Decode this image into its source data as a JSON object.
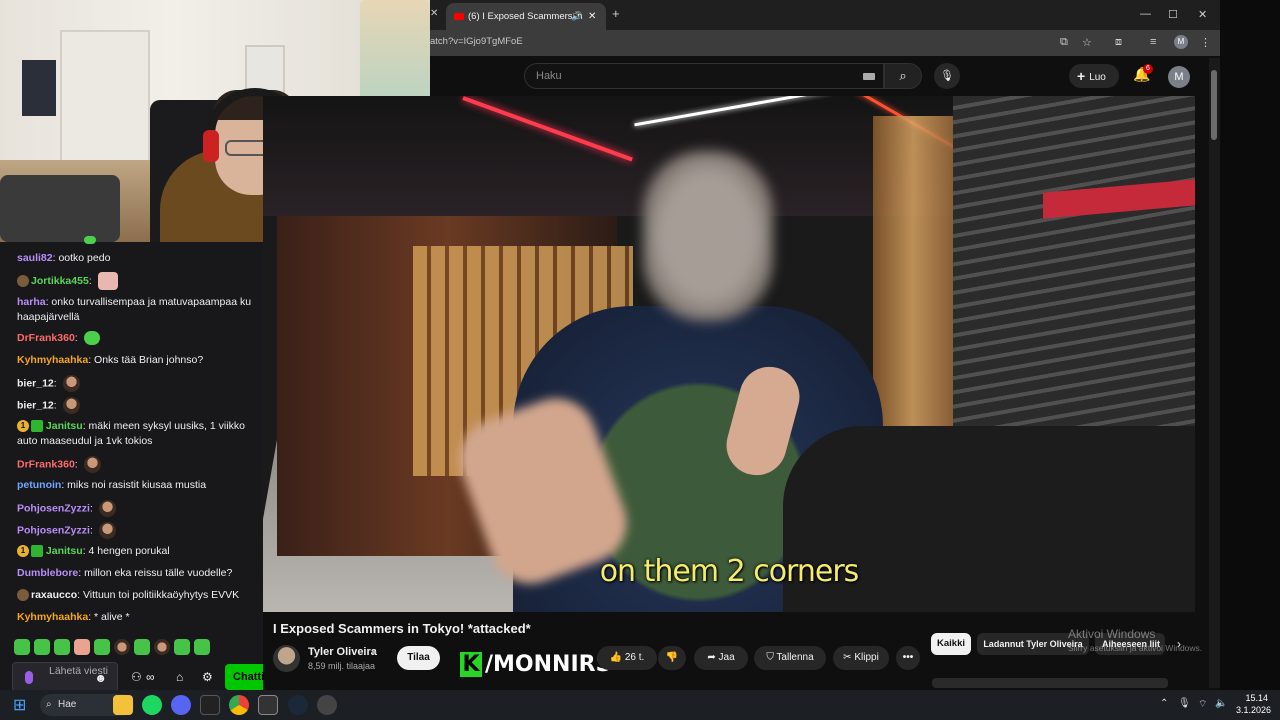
{
  "browser": {
    "tab_title": "(6) I Exposed Scammers in",
    "url": "atch?v=IGjo9TgMFoE",
    "close_glyph": "✕",
    "new_tab_glyph": "+"
  },
  "youtube": {
    "search_placeholder": "Haku",
    "create_label": "Luo",
    "notification_count": "6",
    "avatar_letter": "M",
    "video_title": "I Exposed Scammers in Tokyo! *attacked*",
    "subtitle": "on them 2 corners",
    "channel": {
      "name": "Tyler Oliveira",
      "subscribers": "8,59 milj. tilaajaa",
      "subscribe_label": "Tilaa"
    },
    "actions": {
      "likes": "26 t.",
      "share": "Jaa",
      "save": "Tallenna",
      "clip": "Klippi",
      "more": "•••"
    },
    "chips": [
      "Kaikki",
      "Ladannut Tyler Oliveira",
      "Aiheeseen liit"
    ],
    "brand_overlay": {
      "k": "K",
      "text": "/MONNIRS"
    }
  },
  "chat": {
    "messages": [
      {
        "user": "sauli82",
        "user_color": "#b98ef7",
        "text": " ootko pedo"
      },
      {
        "user": "Jortikka455",
        "user_color": "#59d559",
        "text": ""
      },
      {
        "user": "harha",
        "user_color": "#b98ef7",
        "text": " onko turvallisempaa ja matuvapaampaa ku haapajärvellä"
      },
      {
        "user": "DrFrank360",
        "user_color": "#ff6b6b",
        "text": ""
      },
      {
        "user": "Kyhmyhaahka",
        "user_color": "#f5a623",
        "text": " Onks tää Brian johnso?"
      },
      {
        "user": "bier_12",
        "user_color": "#efeff1",
        "text": ""
      },
      {
        "user": "bier_12",
        "user_color": "#efeff1",
        "text": ""
      },
      {
        "user": "Janitsu",
        "user_color": "#59d559",
        "text": " mäki meen syksyl uusiks, 1 viikko auto maaseudul ja 1vk tokios"
      },
      {
        "user": "DrFrank360",
        "user_color": "#ff6b6b",
        "text": ""
      },
      {
        "user": "petunoin",
        "user_color": "#6fa8ff",
        "text": " miks noi rasistit kiusaa mustia"
      },
      {
        "user": "PohjosenZyzzi",
        "user_color": "#b98ef7",
        "text": ""
      },
      {
        "user": "PohjosenZyzzi",
        "user_color": "#b98ef7",
        "text": ""
      },
      {
        "user": "Janitsu",
        "user_color": "#59d559",
        "text": " 4 hengen porukal"
      },
      {
        "user": "Dumblebore",
        "user_color": "#b98ef7",
        "text": " millon eka reissu tälle vuodelle?"
      },
      {
        "user": "raxaucco",
        "user_color": "#efeff1",
        "text": " Vittuun toi politiikkaöyhytys EVVK"
      },
      {
        "user": "Kyhmyhaahka",
        "user_color": "#f5a623",
        "text": " * alive *"
      }
    ],
    "input_placeholder": "Lähetä viesti",
    "chat_button": "Chatti",
    "badge_count": "1"
  },
  "windows": {
    "watermark_title": "Aktivoi Windows",
    "watermark_sub": "Siirry asetuksiin ja aktivoi Windows.",
    "search_label": "Hae",
    "time": "15.14",
    "date": "3.1.2026"
  },
  "colors": {
    "youtube_red": "#ff0000",
    "twitch_purple": "#9146ff",
    "subtitle_yellow": "#f4ec6a",
    "chat_button_green": "#00c800"
  }
}
